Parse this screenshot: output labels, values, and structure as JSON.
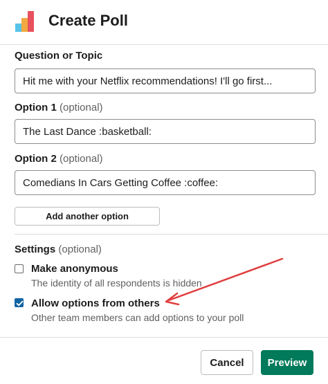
{
  "dialog": {
    "title": "Create Poll",
    "logo_icon": "poll-bars-logo",
    "colors": {
      "accent_green": "#007a5a",
      "checkbox_blue": "#1264a3",
      "annotation_red": "#e03e3e"
    }
  },
  "question": {
    "label": "Question or Topic",
    "value": "Hit me with your Netflix recommendations! I'll go first..."
  },
  "options": [
    {
      "label": "Option 1",
      "optional": "(optional)",
      "value": "The Last Dance :basketball:"
    },
    {
      "label": "Option 2",
      "optional": "(optional)",
      "value": "Comedians In Cars Getting Coffee :coffee:"
    }
  ],
  "add_option_label": "Add another option",
  "settings": {
    "label": "Settings",
    "optional": "(optional)",
    "items": [
      {
        "title": "Make anonymous",
        "description": "The identity of all respondents is hidden",
        "checked": false
      },
      {
        "title": "Allow options from others",
        "description": "Other team members can add options to your poll",
        "checked": true
      }
    ]
  },
  "footer": {
    "cancel_label": "Cancel",
    "preview_label": "Preview"
  }
}
